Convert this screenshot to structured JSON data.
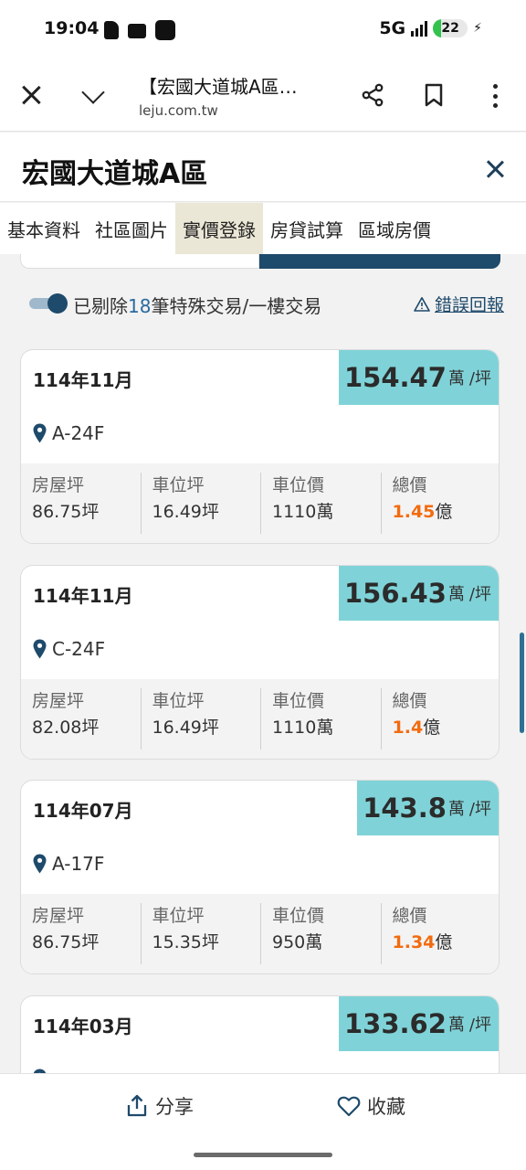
{
  "status_bar": {
    "time": "19:04",
    "network": "5G",
    "battery": "22",
    "battery_level": 0.22,
    "icons": [
      "document-icon",
      "tv-icon",
      "app-icon"
    ]
  },
  "browser": {
    "title": "【宏國大道城A區…",
    "url": "leju.com.tw",
    "icons": [
      "close-icon",
      "chevron-down-icon",
      "share-icon",
      "bookmark-icon",
      "more-icon"
    ]
  },
  "page": {
    "title": "宏國大道城A區"
  },
  "tabs": [
    {
      "label": "基本資料",
      "active": false
    },
    {
      "label": "社區圖片",
      "active": false
    },
    {
      "label": "實價登錄",
      "active": true
    },
    {
      "label": "房貸試算",
      "active": false
    },
    {
      "label": "區域房價",
      "active": false
    }
  ],
  "filter": {
    "prefix": "已剔除",
    "count": "18",
    "suffix": "筆特殊交易/一樓交易",
    "toggle_on": true,
    "report_label": "錯誤回報"
  },
  "stat_labels": {
    "area": "房屋坪",
    "parking_area": "車位坪",
    "parking_price": "車位價",
    "total": "總價"
  },
  "price_unit": "萬",
  "price_sub": "/坪",
  "total_unit": "億",
  "transactions": [
    {
      "date": "114年11月",
      "unit_price": "154.47",
      "location": "A-24F",
      "area": "86.75坪",
      "parking_area": "16.49坪",
      "parking_price": "1110萬",
      "total": "1.45"
    },
    {
      "date": "114年11月",
      "unit_price": "156.43",
      "location": "C-24F",
      "area": "82.08坪",
      "parking_area": "16.49坪",
      "parking_price": "1110萬",
      "total": "1.4"
    },
    {
      "date": "114年07月",
      "unit_price": "143.8",
      "location": "A-17F",
      "area": "86.75坪",
      "parking_area": "15.35坪",
      "parking_price": "950萬",
      "total": "1.34"
    },
    {
      "date": "114年03月",
      "unit_price": "133.62",
      "location": "",
      "area": "",
      "parking_area": "",
      "parking_price": "",
      "total": ""
    }
  ],
  "bottom_bar": {
    "share_label": "分享",
    "favorite_label": "收藏"
  },
  "colors": {
    "accent_dark": "#1e4a6b",
    "price_box": "#7fd3d8",
    "highlight": "#f26b0f",
    "active_tab": "#ebe7d6"
  }
}
